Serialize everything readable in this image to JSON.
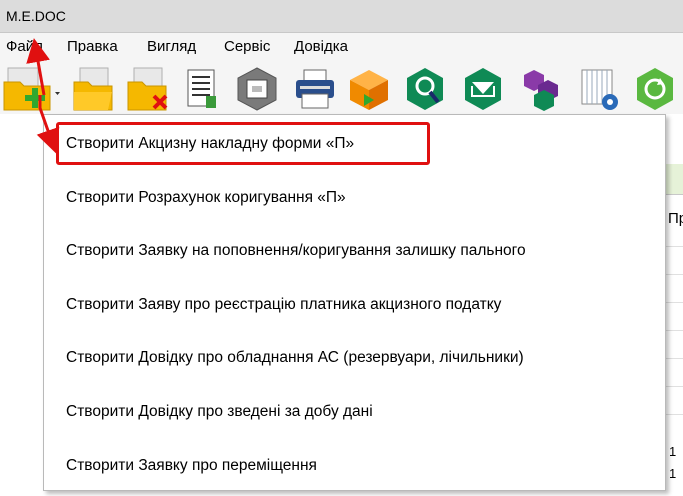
{
  "window": {
    "title": "M.E.DOC"
  },
  "menu": {
    "items": [
      "Файл",
      "Правка",
      "Вигляд",
      "Сервіс",
      "Довідка"
    ]
  },
  "toolbar": {
    "icons": [
      "new-document-icon",
      "open-folder-icon",
      "delete-folder-icon",
      "document-list-icon",
      "archive-box-icon",
      "printer-icon",
      "send-envelope-icon",
      "search-hexagon-icon",
      "receive-envelope-icon",
      "hexagons-icon",
      "calendar-settings-icon",
      "refresh-icon"
    ]
  },
  "dropdown": {
    "items": [
      "Створити Акцизну накладну форми «П»",
      "Створити Розрахунок коригування «П»",
      "Створити Заявку на поповнення/коригування залишку пального",
      "Створити Заяву про реєстрацію платника акцизного податку",
      "Створити Довідку про обладнання АС (резервуари, лічильники)",
      "Створити Довідку про зведені за добу дані",
      "Створити Заявку про переміщення"
    ]
  },
  "background": {
    "column_header": "Пр",
    "cells": [
      "1",
      "1"
    ]
  },
  "colors": {
    "highlight": "#e01010",
    "arrow": "#e01010",
    "folder": "#f5b800",
    "plus": "#2fa82f"
  }
}
